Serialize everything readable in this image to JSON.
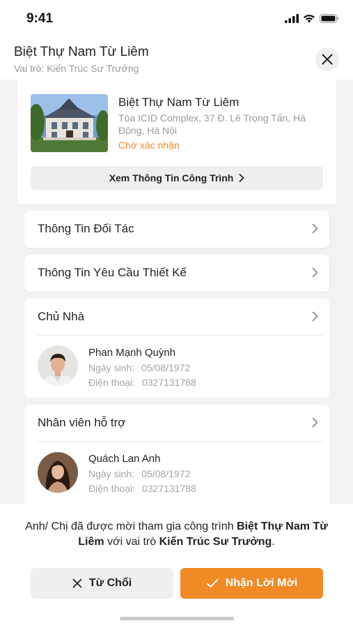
{
  "status_bar": {
    "time": "9:41"
  },
  "header": {
    "title": "Biệt Thự Nam Từ Liêm",
    "subtitle": "Vai trò: Kiến Trúc Sư Trưởng"
  },
  "project": {
    "name": "Biệt Thự Nam Từ Liêm",
    "address": "Tòa ICID Complex, 37 Đ. Lê Trọng Tấn, Hà Đông, Hà Nội",
    "status": "Chờ xác nhận",
    "view_button": "Xem Thông Tin Công Trình"
  },
  "rows": {
    "partner_info": "Thông Tin Đối Tác",
    "design_request": "Thông Tin Yêu Cầu Thiết Kế"
  },
  "owner": {
    "section_title": "Chủ Nhà",
    "name": "Phan Mạnh Quỳnh",
    "dob_label": "Ngày sinh:",
    "dob": "05/08/1972",
    "phone_label": "Điện thoại:",
    "phone": "0327131788"
  },
  "support": {
    "section_title": "Nhân viên hỗ trợ",
    "name": "Quách Lan Anh",
    "dob_label": "Ngày sinh:",
    "dob": "05/08/1972",
    "phone_label": "Điện thoại:",
    "phone": "0327131788"
  },
  "invite": {
    "text_prefix": "Anh/ Chị đã được mời tham gia công trình ",
    "project_name": "Biệt Thự Nam Từ Liêm",
    "text_middle": " với vai trò ",
    "role": "Kiến Trúc Sư Trưởng",
    "text_suffix": "."
  },
  "buttons": {
    "reject": "Từ Chối",
    "accept": "Nhận Lời Mời"
  },
  "colors": {
    "accent": "#f08a24",
    "background": "#f2f2f4"
  }
}
